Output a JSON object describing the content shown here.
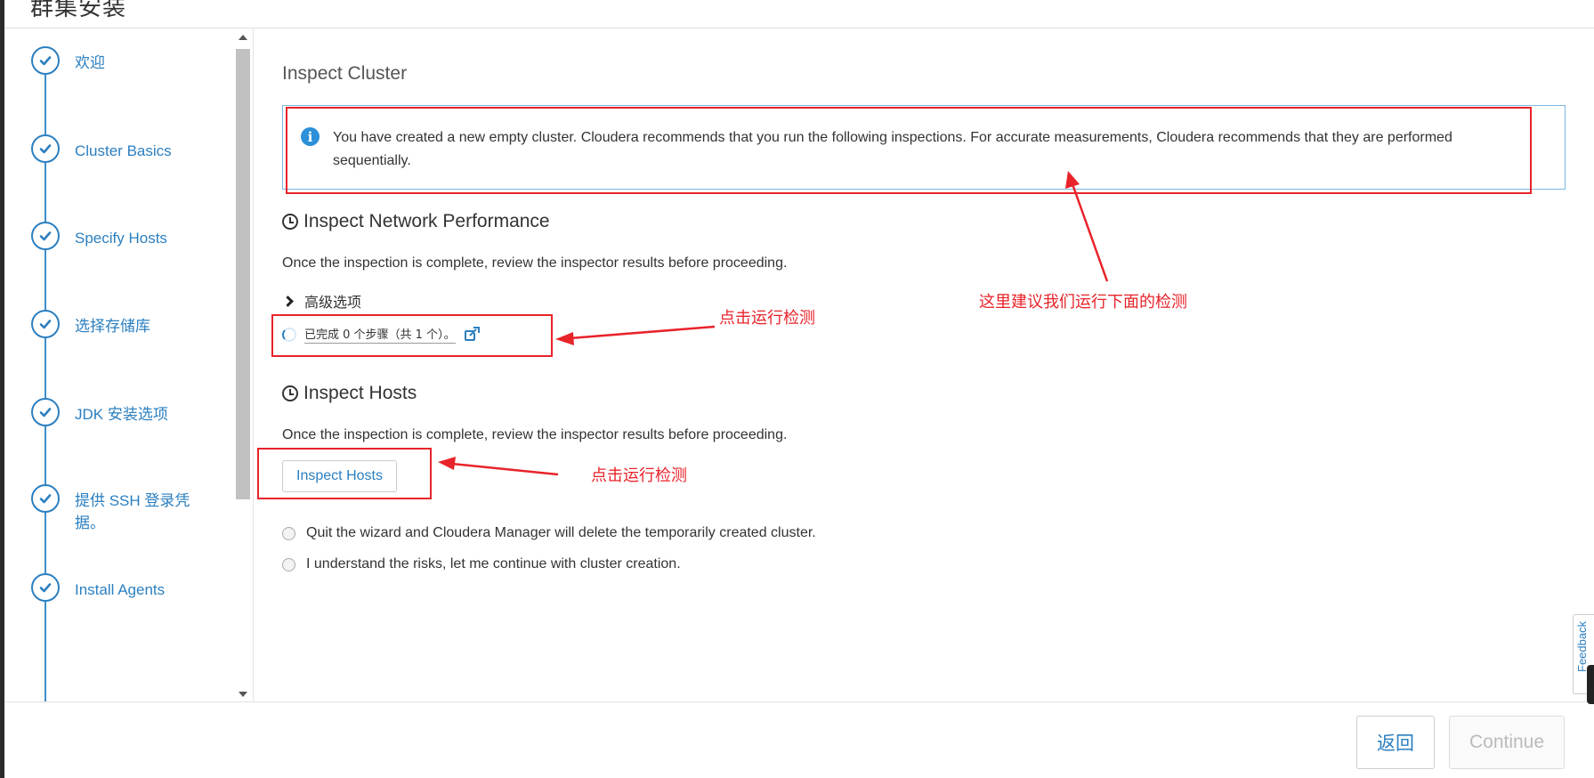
{
  "page_title": "群集安装",
  "sidebar": {
    "steps": [
      {
        "label": "欢迎"
      },
      {
        "label": "Cluster Basics"
      },
      {
        "label": "Specify Hosts"
      },
      {
        "label": "选择存储库"
      },
      {
        "label": "JDK 安装选项"
      },
      {
        "label": "提供 SSH 登录凭据。"
      },
      {
        "label": "Install Agents"
      }
    ]
  },
  "main": {
    "title": "Inspect Cluster",
    "info_message": "You have created a new empty cluster. Cloudera recommends that you run the following inspections. For accurate measurements, Cloudera recommends that they are performed sequentially.",
    "network": {
      "title": "Inspect Network Performance",
      "description": "Once the inspection is complete, review the inspector results before proceeding.",
      "advanced_label": "高级选项",
      "progress_text": "已完成 0 个步骤（共 1 个）。"
    },
    "hosts": {
      "title": "Inspect Hosts",
      "description": "Once the inspection is complete, review the inspector results before proceeding.",
      "button_label": "Inspect Hosts"
    },
    "options": [
      {
        "label": "Quit the wizard and Cloudera Manager will delete the temporarily created cluster."
      },
      {
        "label": "I understand the risks, let me continue with cluster creation."
      }
    ]
  },
  "annotations": {
    "info_note": "这里建议我们运行下面的检测",
    "network_note": "点击运行检测",
    "hosts_note": "点击运行检测"
  },
  "footer": {
    "back_label": "返回",
    "continue_label": "Continue"
  },
  "feedback_label": "Feedback",
  "colors": {
    "accent": "#2b7fc0",
    "annotation": "#e8232a",
    "info_border": "#7ab8e2"
  }
}
